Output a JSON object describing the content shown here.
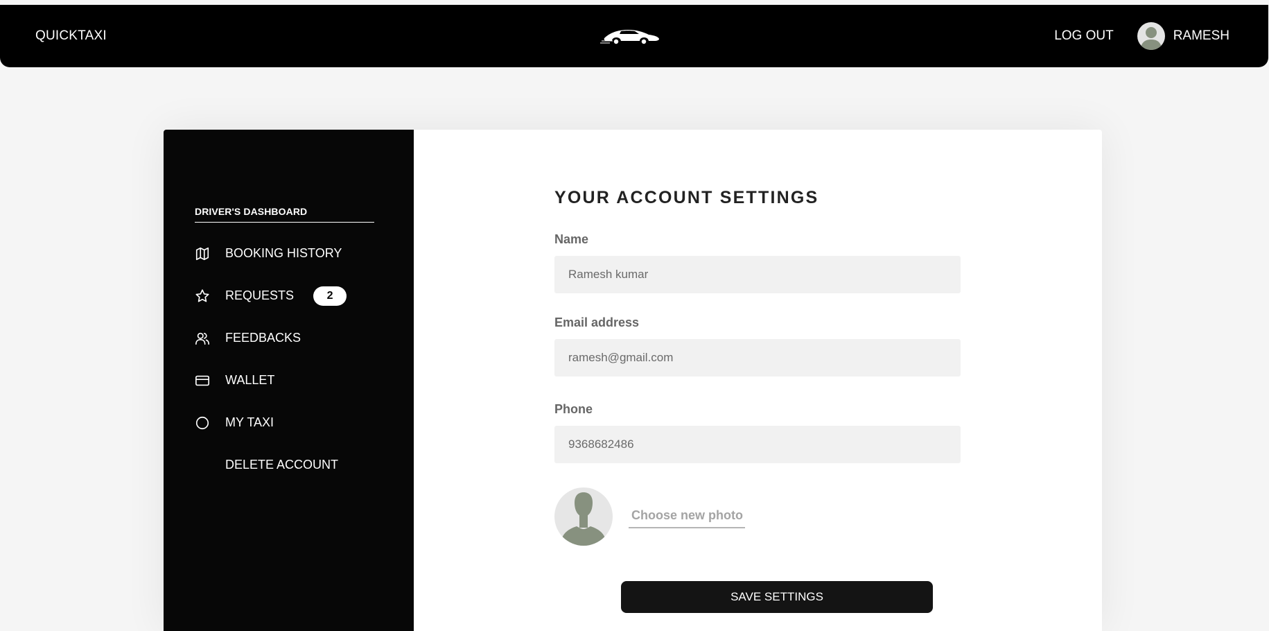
{
  "header": {
    "brand": "QUICKTAXI",
    "logo_icon": "car-icon",
    "logout_label": "LOG OUT",
    "user_name": "RAMESH",
    "avatar_icon": "user-avatar-icon"
  },
  "sidebar": {
    "title": "DRIVER'S DASHBOARD",
    "items": [
      {
        "label": "BOOKING HISTORY",
        "icon": "map-icon"
      },
      {
        "label": "REQUESTS",
        "icon": "star-icon",
        "badge": "2"
      },
      {
        "label": "FEEDBACKS",
        "icon": "users-icon"
      },
      {
        "label": "WALLET",
        "icon": "credit-card-icon"
      },
      {
        "label": "MY TAXI",
        "icon": "circle-icon"
      },
      {
        "label": "DELETE ACCOUNT",
        "icon": ""
      }
    ]
  },
  "settings": {
    "heading": "YOUR ACCOUNT SETTINGS",
    "name_label": "Name",
    "name_value": "Ramesh kumar",
    "email_label": "Email address",
    "email_value": "ramesh@gmail.com",
    "phone_label": "Phone",
    "phone_value": "9368682486",
    "choose_photo_label": "Choose new photo",
    "save_label": "SAVE SETTINGS"
  },
  "colors": {
    "topbar": "#000000",
    "sidebar": "#070707",
    "page_bg": "#f5f5f5",
    "field_bg": "#f1f1f1",
    "avatar_silhouette": "#87917f"
  }
}
